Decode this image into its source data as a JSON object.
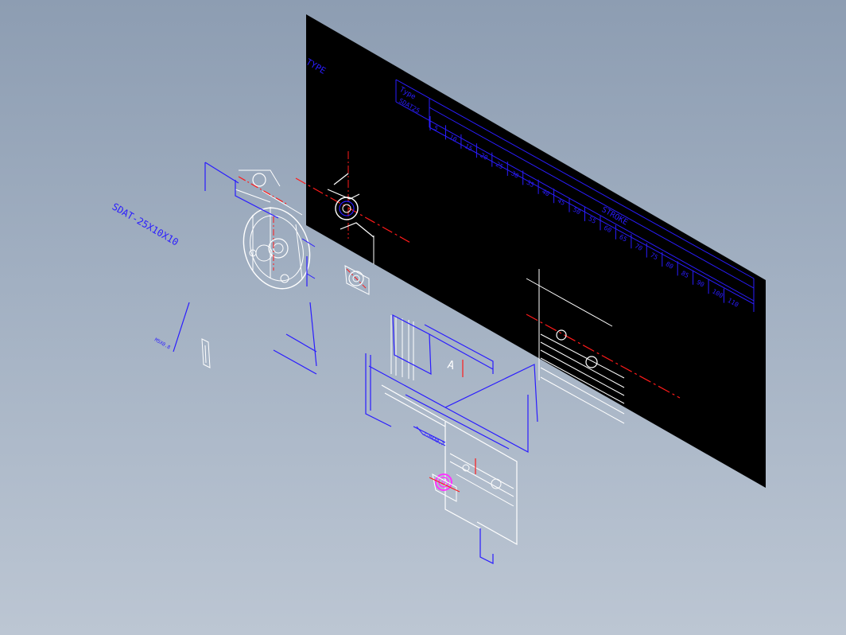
{
  "colors": {
    "background_top": "#8d9db2",
    "background_bottom": "#bcc6d3",
    "sheet": "#000000",
    "annotation": "#2a1cff",
    "geometry": "#ffffff",
    "centerline": "#ff1a1a",
    "highlight": "#ff33ff"
  },
  "drawing": {
    "model_label": "SDAT-25X10X10",
    "small_note": "M5X0.8",
    "small_note_2": "2-M4X0.7",
    "table_heading": "TYPE",
    "table_col1_header": "Type",
    "table_col1_value": "SDAT25",
    "stroke_header": "STROKE",
    "view_letter": "A",
    "strokes": [
      "5",
      "10",
      "15",
      "20",
      "25",
      "30",
      "35",
      "40",
      "45",
      "50",
      "55",
      "60",
      "65",
      "70",
      "75",
      "80",
      "85",
      "90",
      "100",
      "110"
    ]
  }
}
